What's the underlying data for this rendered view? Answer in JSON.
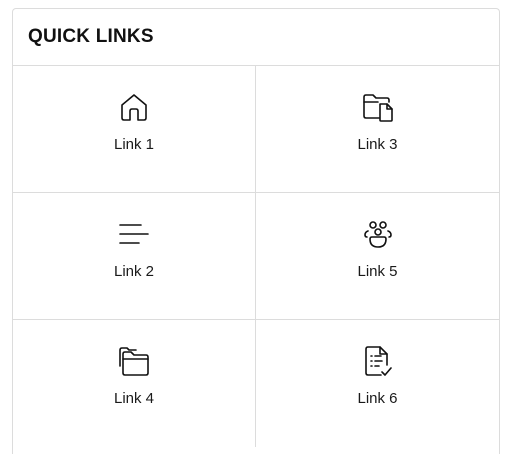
{
  "widget": {
    "title": "QUICK LINKS"
  },
  "links": [
    {
      "label": "Link 1",
      "icon": "home-icon"
    },
    {
      "label": "Link 3",
      "icon": "folder-document-icon"
    },
    {
      "label": "Link 2",
      "icon": "menu-lines-icon"
    },
    {
      "label": "Link 5",
      "icon": "people-group-icon"
    },
    {
      "label": "Link 4",
      "icon": "folders-icon"
    },
    {
      "label": "Link 6",
      "icon": "document-checklist-icon"
    }
  ]
}
